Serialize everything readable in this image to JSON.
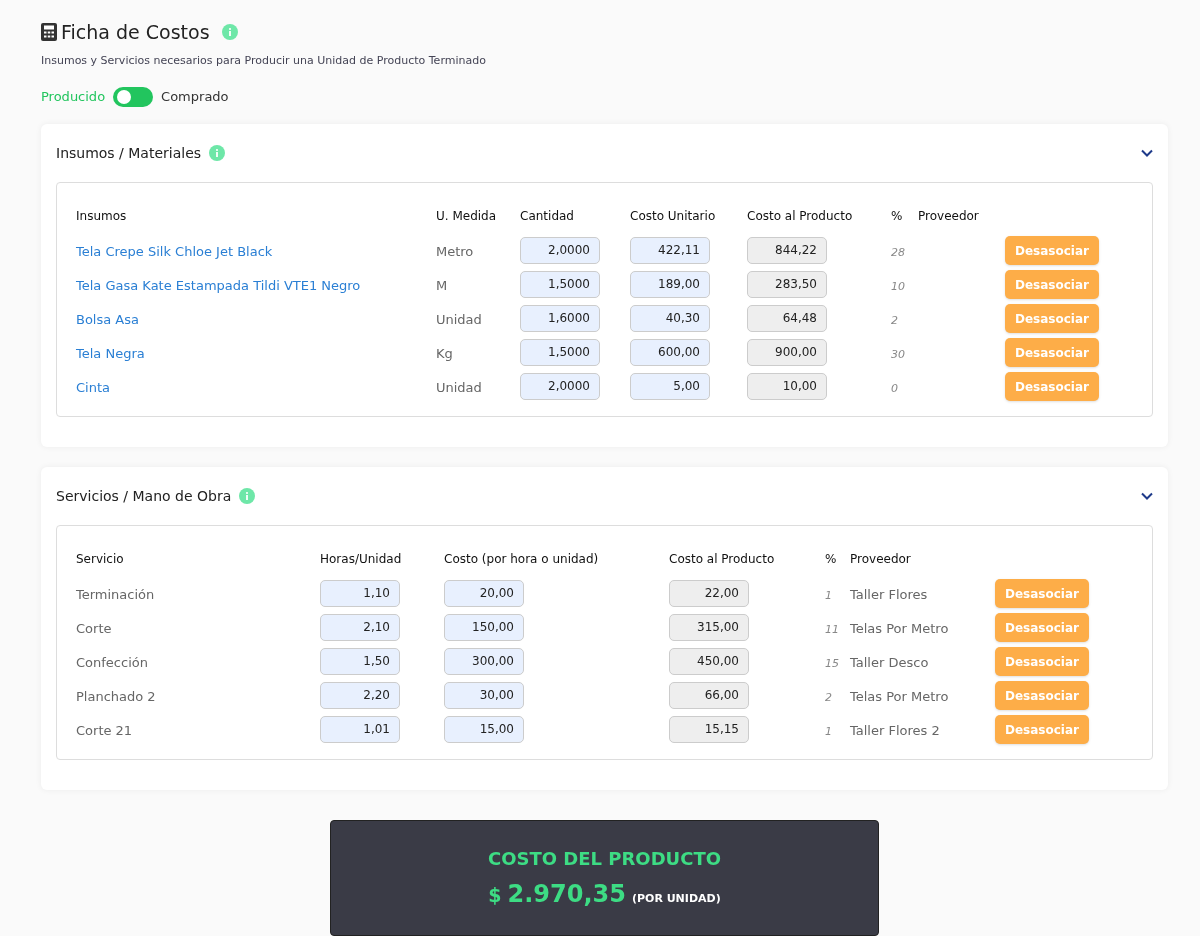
{
  "header": {
    "title": "Ficha de Costos",
    "subtitle": "Insumos y Servicios necesarios para Producir una Unidad de Producto Terminado"
  },
  "origin_toggle": {
    "options": [
      {
        "label": "Producido",
        "selected": true
      },
      {
        "label": "Comprado",
        "selected": false
      }
    ]
  },
  "sections": [
    {
      "kind": "insumos",
      "title": "Insumos / Materiales",
      "expanded": true,
      "columns": [
        "Insumos",
        "U. Medida",
        "Cantidad",
        "Costo Unitario",
        "Costo al Producto",
        "%",
        "Proveedor"
      ],
      "rows": [
        {
          "name": "Tela Crepe Silk Chloe Jet Black",
          "unit": "Metro",
          "quantity": "2,0000",
          "unit_cost": "422,11",
          "product_cost": "844,22",
          "percent": "28",
          "button": "Desasociar"
        },
        {
          "name": "Tela Gasa Kate Estampada Tildi VTE1 Negro",
          "unit": "M",
          "quantity": "1,5000",
          "unit_cost": "189,00",
          "product_cost": "283,50",
          "percent": "10",
          "button": "Desasociar"
        },
        {
          "name": "Bolsa Asa",
          "unit": "Unidad",
          "quantity": "1,6000",
          "unit_cost": "40,30",
          "product_cost": "64,48",
          "percent": "2",
          "button": "Desasociar"
        },
        {
          "name": "Tela Negra",
          "unit": "Kg",
          "quantity": "1,5000",
          "unit_cost": "600,00",
          "product_cost": "900,00",
          "percent": "30",
          "button": "Desasociar"
        },
        {
          "name": "Cinta",
          "unit": "Unidad",
          "quantity": "2,0000",
          "unit_cost": "5,00",
          "product_cost": "10,00",
          "percent": "0",
          "button": "Desasociar"
        }
      ]
    },
    {
      "kind": "servicios",
      "title": "Servicios / Mano de Obra",
      "expanded": true,
      "columns": [
        "Servicio",
        "Horas/Unidad",
        "Costo (por hora o unidad)",
        "Costo al Producto",
        "%",
        "Proveedor"
      ],
      "rows": [
        {
          "name": "Terminación",
          "hours": "1,10",
          "cost": "20,00",
          "product_cost": "22,00",
          "percent": "1",
          "supplier": "Taller Flores",
          "button": "Desasociar"
        },
        {
          "name": "Corte",
          "hours": "2,10",
          "cost": "150,00",
          "product_cost": "315,00",
          "percent": "11",
          "supplier": "Telas Por Metro",
          "button": "Desasociar"
        },
        {
          "name": "Confección",
          "hours": "1,50",
          "cost": "300,00",
          "product_cost": "450,00",
          "percent": "15",
          "supplier": "Taller Desco",
          "button": "Desasociar"
        },
        {
          "name": "Planchado 2",
          "hours": "2,20",
          "cost": "30,00",
          "product_cost": "66,00",
          "percent": "2",
          "supplier": "Telas Por Metro",
          "button": "Desasociar"
        },
        {
          "name": "Corte 21",
          "hours": "1,01",
          "cost": "15,00",
          "product_cost": "15,15",
          "percent": "1",
          "supplier": "Taller Flores 2",
          "button": "Desasociar"
        }
      ]
    }
  ],
  "total": {
    "label": "COSTO DEL PRODUCTO",
    "currency": "$",
    "amount": "2.970,35",
    "unit_note": "(POR UNIDAD)"
  }
}
